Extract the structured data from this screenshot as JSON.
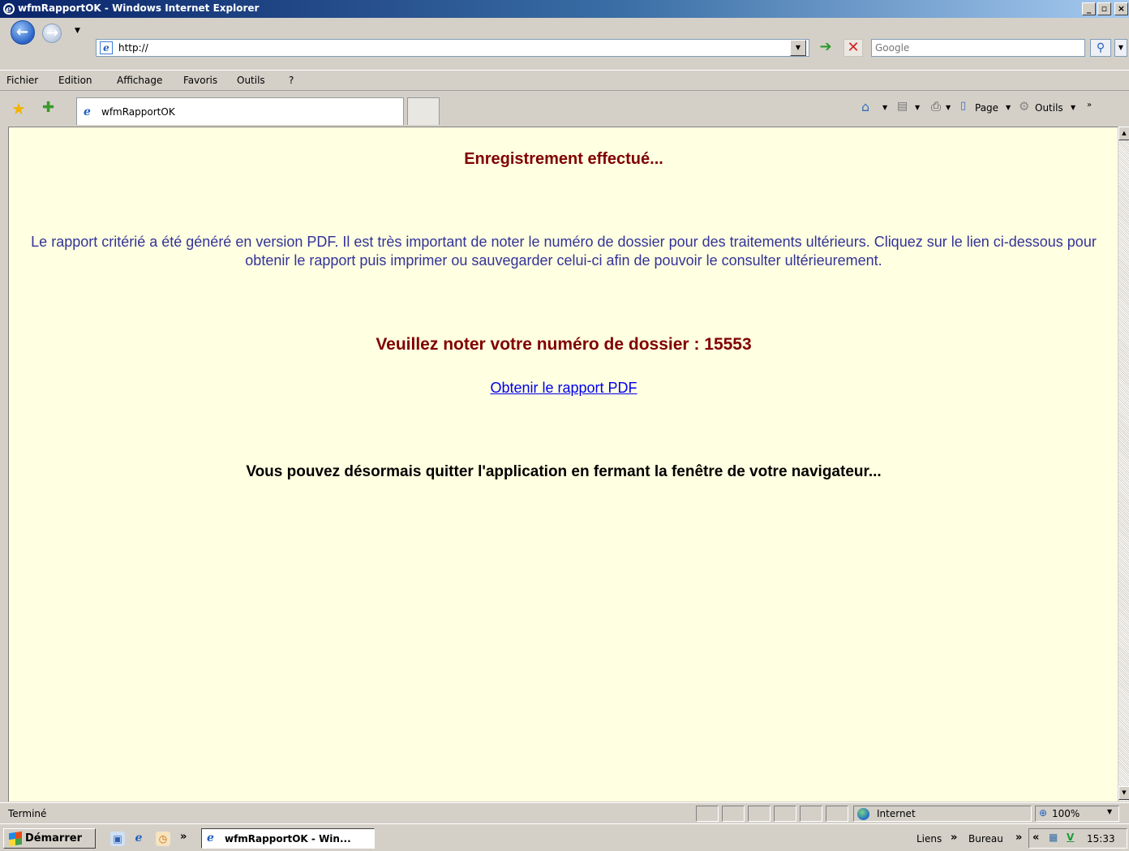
{
  "window": {
    "title": "wfmRapportOK - Windows Internet Explorer",
    "minimize_glyph": "_",
    "maximize_glyph": "▫",
    "close_glyph": "×"
  },
  "addressbar": {
    "url": "http://",
    "search_placeholder": "Google"
  },
  "menu": [
    "Fichier",
    "Edition",
    "Affichage",
    "Favoris",
    "Outils",
    "?"
  ],
  "tab": {
    "label": "wfmRapportOK"
  },
  "commands": {
    "page_label": "Page",
    "tools_label": "Outils"
  },
  "content": {
    "saved_heading": "Enregistrement effectué...",
    "info_text": "Le rapport critérié a été généré en version PDF. Il est très important de noter le numéro de dossier pour des traitements ultérieurs. Cliquez sur le lien ci-dessous pour obtenir le rapport puis imprimer ou sauvegarder celui-ci afin de pouvoir le consulter ultérieurement.",
    "dossier_heading": "Veuillez noter votre numéro de dossier : 15553",
    "pdf_link": "Obtenir le rapport PDF",
    "quit_text": "Vous pouvez désormais quitter l'application en fermant la fenêtre de votre navigateur..."
  },
  "status": {
    "text": "Terminé",
    "zone": "Internet",
    "zoom": "100%"
  },
  "taskbar": {
    "start_label": "Démarrer",
    "task_label": "wfmRapportOK - Win...",
    "links_label": "Liens",
    "desktop_label": "Bureau",
    "clock": "15:33"
  },
  "colors": {
    "page_background": "#ffffe1",
    "heading_red": "#800000",
    "info_blue": "#333399",
    "link_blue": "#0000ee"
  },
  "icons": [
    "ie-logo-icon",
    "back-icon",
    "forward-icon",
    "go-icon",
    "stop-icon",
    "search-icon",
    "favorites-star-icon",
    "add-favorites-icon",
    "home-icon",
    "feeds-icon",
    "print-icon",
    "page-icon",
    "tools-gear-icon",
    "internet-zone-icon",
    "zoom-icon",
    "windows-start-icon"
  ]
}
